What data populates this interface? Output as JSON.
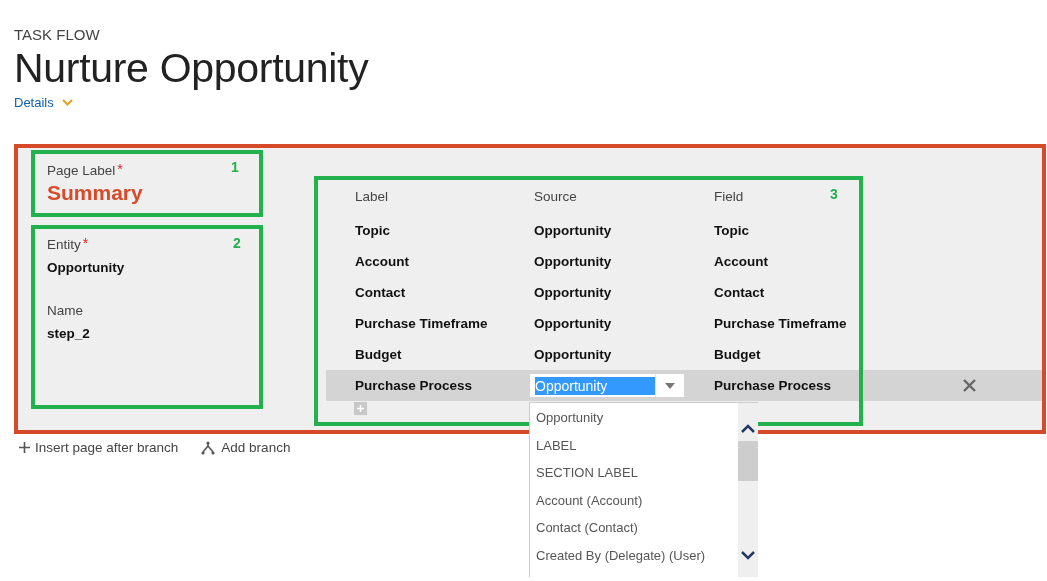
{
  "header": {
    "eyebrow": "TASK FLOW",
    "title": "Nurture Opportunity",
    "details_link": "Details"
  },
  "step": {
    "page_label": {
      "label": "Page Label",
      "required_mark": "*",
      "value": "Summary"
    },
    "entity": {
      "label": "Entity",
      "required_mark": "*",
      "value": "Opportunity"
    },
    "name": {
      "label": "Name",
      "value": "step_2"
    }
  },
  "table": {
    "columns": [
      "Label",
      "Source",
      "Field"
    ],
    "rows": [
      {
        "label": "Topic",
        "source": "Opportunity",
        "field": "Topic",
        "selected": false
      },
      {
        "label": "Account",
        "source": "Opportunity",
        "field": "Account",
        "selected": false
      },
      {
        "label": "Contact",
        "source": "Opportunity",
        "field": "Contact",
        "selected": false
      },
      {
        "label": "Purchase Timeframe",
        "source": "Opportunity",
        "field": "Purchase Timeframe",
        "selected": false
      },
      {
        "label": "Budget",
        "source": "Opportunity",
        "field": "Budget",
        "selected": false
      },
      {
        "label": "Purchase Process",
        "source": "Opportunity",
        "field": "Purchase Process",
        "selected": true,
        "source_editor": {
          "open": true,
          "options": [
            "Opportunity",
            "LABEL",
            "SECTION LABEL",
            "Account (Account)",
            "Contact (Contact)",
            "Created By (Delegate) (User)"
          ]
        }
      }
    ]
  },
  "annotations": [
    {
      "number": "1"
    },
    {
      "number": "2"
    },
    {
      "number": "3"
    }
  ],
  "actions": [
    {
      "kind": "insert",
      "label": "Insert page after branch"
    },
    {
      "kind": "branch",
      "label": "Add branch"
    }
  ]
}
